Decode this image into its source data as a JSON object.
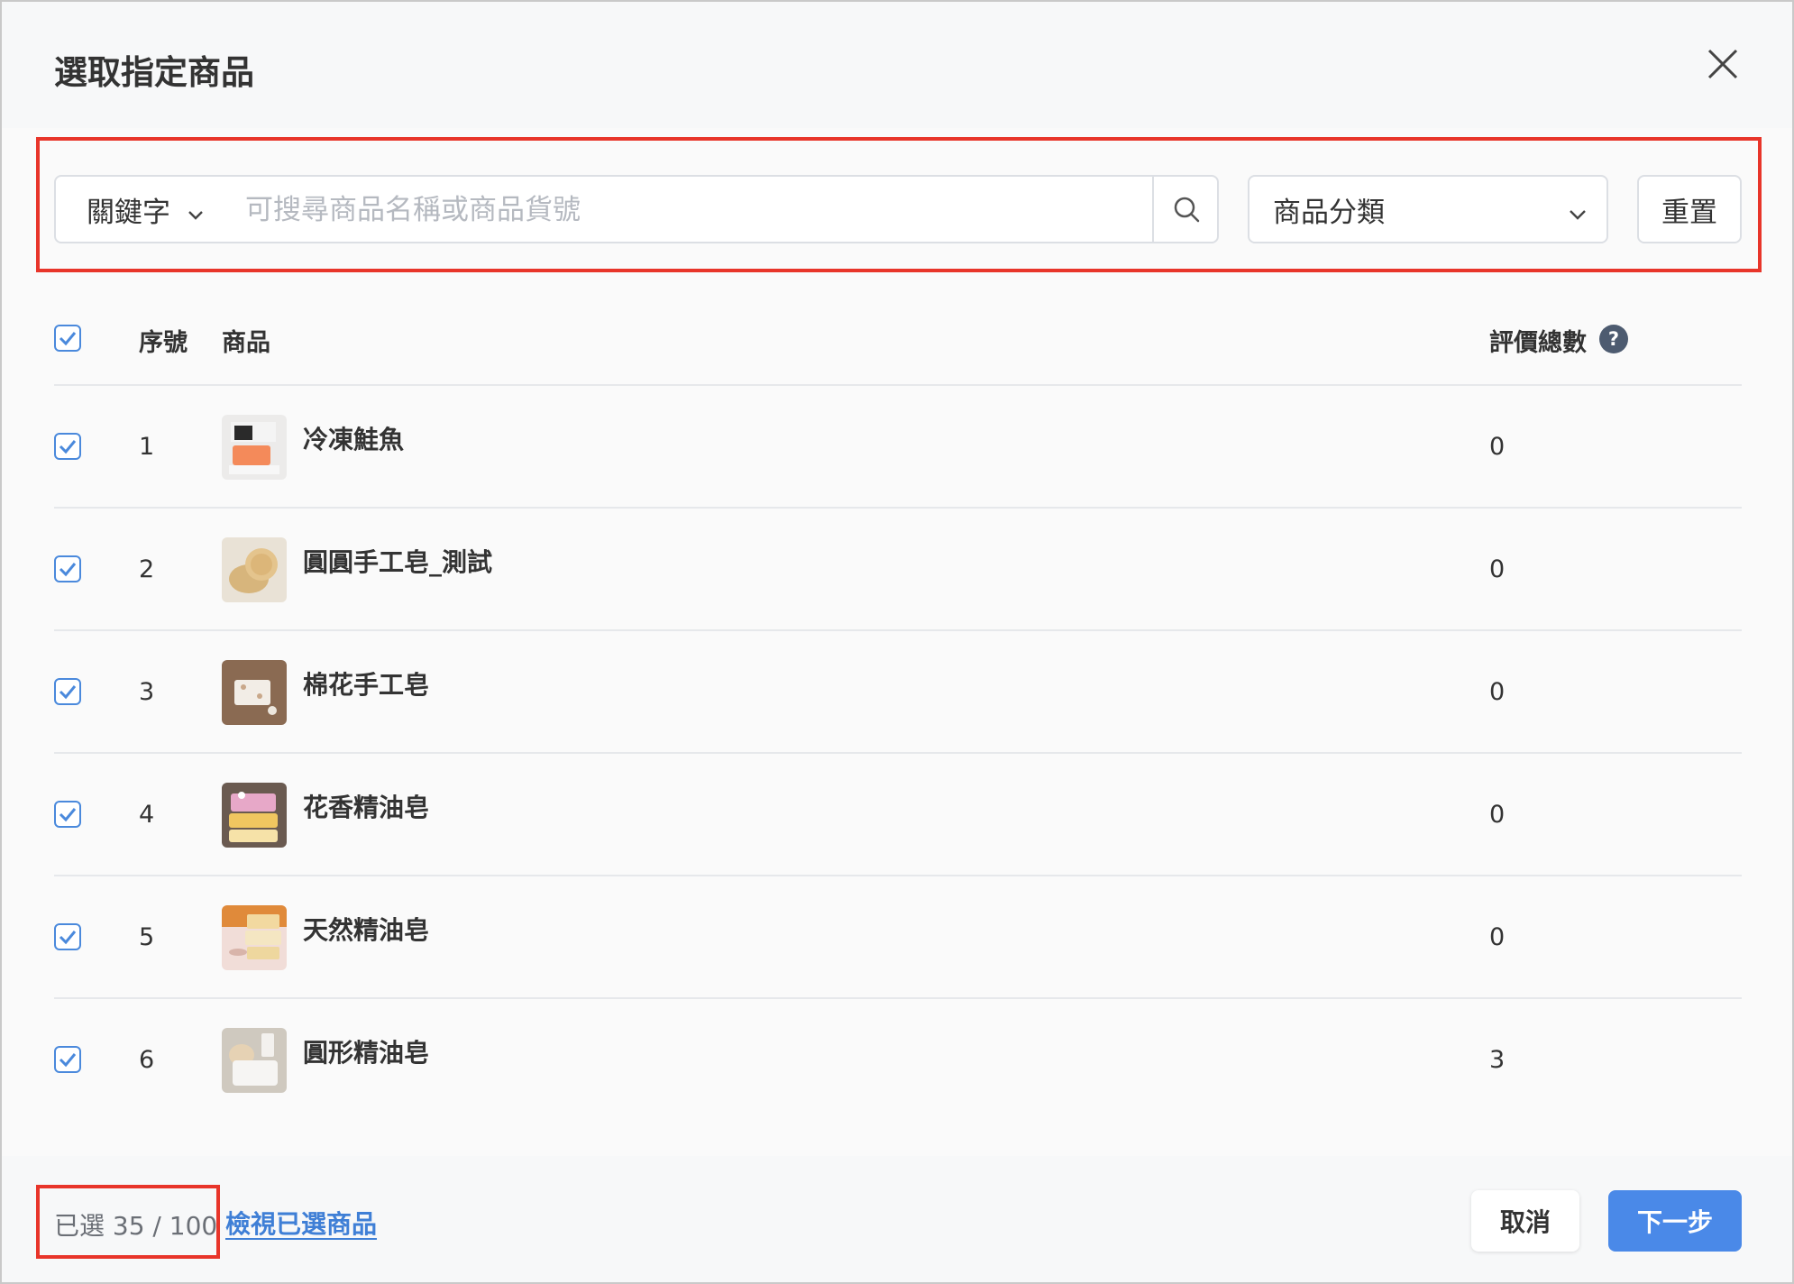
{
  "dialog": {
    "title": "選取指定商品"
  },
  "filters": {
    "keyword_type": "關鍵字",
    "search_placeholder": "可搜尋商品名稱或商品貨號",
    "category_placeholder": "商品分類",
    "reset_label": "重置"
  },
  "table": {
    "headers": {
      "index": "序號",
      "product": "商品",
      "reviews": "評價總數"
    },
    "rows": [
      {
        "index": "1",
        "name": "冷凍鮭魚",
        "reviews": "0",
        "checked": true
      },
      {
        "index": "2",
        "name": "圓圓手工皂_測試",
        "reviews": "0",
        "checked": true
      },
      {
        "index": "3",
        "name": "棉花手工皂",
        "reviews": "0",
        "checked": true
      },
      {
        "index": "4",
        "name": "花香精油皂",
        "reviews": "0",
        "checked": true
      },
      {
        "index": "5",
        "name": "天然精油皂",
        "reviews": "0",
        "checked": true
      },
      {
        "index": "6",
        "name": "圓形精油皂",
        "reviews": "3",
        "checked": true
      }
    ]
  },
  "footer": {
    "selected_count": "已選 35 / 100",
    "view_selected_label": "檢視已選商品",
    "cancel_label": "取消",
    "next_label": "下一步"
  },
  "colors": {
    "accent": "#4a89e8",
    "highlight_border": "#e8352a"
  }
}
